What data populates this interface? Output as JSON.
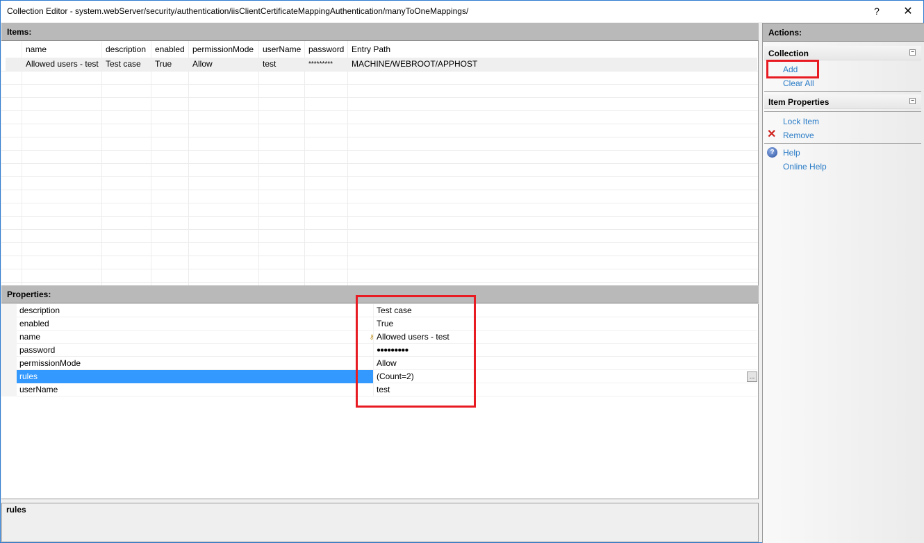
{
  "window": {
    "title": "Collection Editor - system.webServer/security/authentication/iisClientCertificateMappingAuthentication/manyToOneMappings/",
    "help_label": "?",
    "close_label": "✕"
  },
  "items": {
    "header": "Items:",
    "columns": [
      "name",
      "description",
      "enabled",
      "permissionMode",
      "userName",
      "password",
      "Entry Path"
    ],
    "rows": [
      [
        "Allowed users - test",
        "Test case",
        "True",
        "Allow",
        "test",
        "*********",
        "MACHINE/WEBROOT/APPHOST"
      ]
    ]
  },
  "properties": {
    "header": "Properties:",
    "rows": [
      {
        "name": "description",
        "value": "Test case"
      },
      {
        "name": "enabled",
        "value": "True"
      },
      {
        "name": "name",
        "value": "Allowed users - test",
        "key_icon": "key-icon"
      },
      {
        "name": "password",
        "value": "●●●●●●●●●"
      },
      {
        "name": "permissionMode",
        "value": "Allow"
      },
      {
        "name": "rules",
        "value": "(Count=2)",
        "selected": true,
        "ellipsis": "..."
      },
      {
        "name": "userName",
        "value": "test"
      }
    ]
  },
  "description_panel": {
    "title": "rules"
  },
  "actions": {
    "header": "Actions:",
    "groups": [
      {
        "title": "Collection",
        "collapse_icon": "⊟",
        "items": [
          {
            "label": "Add",
            "highlighted": true
          },
          {
            "label": "Clear All"
          }
        ]
      },
      {
        "title": "Item Properties",
        "collapse_icon": "⊟",
        "items": [
          {
            "label": "Lock Item"
          },
          {
            "label": "Remove",
            "icon": "remove-x-icon",
            "glyph": "✕"
          },
          {
            "label": "Help",
            "icon": "help-icon",
            "glyph": "?"
          },
          {
            "label": "Online Help"
          }
        ]
      }
    ]
  },
  "annotation_color": "#e81b23",
  "selection_color": "#3399ff",
  "link_color": "#2a7cc7"
}
